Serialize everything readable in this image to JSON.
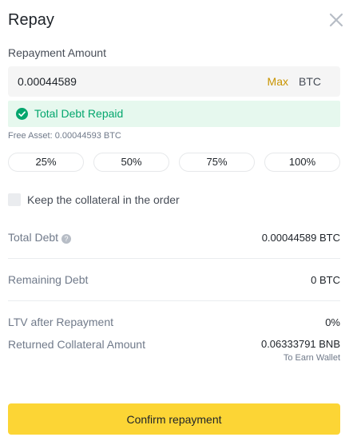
{
  "dialog": {
    "title": "Repay",
    "close_icon": "close-icon"
  },
  "repayment": {
    "label": "Repayment Amount",
    "amount_value": "0.00044589",
    "max_label": "Max",
    "unit": "BTC"
  },
  "status": {
    "icon": "check-circle-icon",
    "text": "Total Debt Repaid",
    "color": "#03a66d",
    "background": "#e6f8ee"
  },
  "free_asset": "Free Asset: 0.00044593 BTC",
  "percent_buttons": [
    "25%",
    "50%",
    "75%",
    "100%"
  ],
  "keep_collateral": {
    "label": "Keep the collateral in the order",
    "checked": false
  },
  "summary": {
    "total_debt": {
      "label": "Total Debt",
      "value": "0.00044589 BTC",
      "icon": "info-icon"
    },
    "remaining_debt": {
      "label": "Remaining Debt",
      "value": "0 BTC"
    },
    "ltv_after": {
      "label": "LTV after Repayment",
      "value": "0%"
    },
    "returned_collateral": {
      "label": "Returned Collateral Amount",
      "value": "0.06333791 BNB",
      "sub": "To Earn Wallet"
    }
  },
  "confirm": {
    "label": "Confirm repayment",
    "color": "#fcd535"
  },
  "colors": {
    "accent": "#c99400",
    "text": "#1e2329",
    "muted": "#707a8a"
  }
}
